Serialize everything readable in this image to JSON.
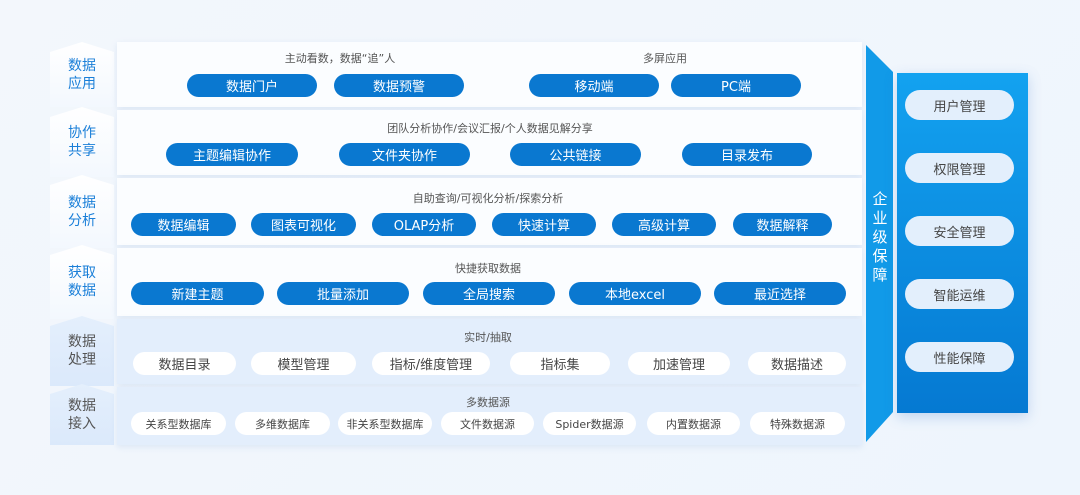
{
  "layers": [
    {
      "label": "数据应用",
      "groups": [
        {
          "title": "主动看数，数据“追”人",
          "items": [
            "数据门户",
            "数据预警"
          ]
        },
        {
          "title": "多屏应用",
          "items": [
            "移动端",
            "PC端"
          ]
        }
      ]
    },
    {
      "label": "协作共享",
      "groups": [
        {
          "title": "团队分析协作/会议汇报/个人数据见解分享",
          "items": [
            "主题编辑协作",
            "文件夹协作",
            "公共链接",
            "目录发布"
          ]
        }
      ]
    },
    {
      "label": "数据分析",
      "groups": [
        {
          "title": "自助查询/可视化分析/探索分析",
          "items": [
            "数据编辑",
            "图表可视化",
            "OLAP分析",
            "快速计算",
            "高级计算",
            "数据解释"
          ]
        }
      ]
    },
    {
      "label": "获取数据",
      "groups": [
        {
          "title": "快捷获取数据",
          "items": [
            "新建主题",
            "批量添加",
            "全局搜索",
            "本地excel",
            "最近选择"
          ]
        }
      ]
    },
    {
      "label": "数据处理",
      "groups": [
        {
          "title": "实时/抽取",
          "items": [
            "数据目录",
            "模型管理",
            "指标/维度管理",
            "指标集",
            "加速管理",
            "数据描述"
          ]
        }
      ]
    },
    {
      "label": "数据接入",
      "groups": [
        {
          "title": "多数据源",
          "items": [
            "关系型数据库",
            "多维数据库",
            "非关系型数据库",
            "文件数据源",
            "Spider数据源",
            "内置数据源",
            "特殊数据源"
          ]
        }
      ]
    }
  ],
  "guarantee": {
    "title": "企业级保障",
    "items": [
      "用户管理",
      "权限管理",
      "安全管理",
      "智能运维",
      "性能保障"
    ]
  },
  "colors": {
    "primary": "#0a78d0",
    "band": "#119ae8",
    "label": "#1a7fd8"
  }
}
